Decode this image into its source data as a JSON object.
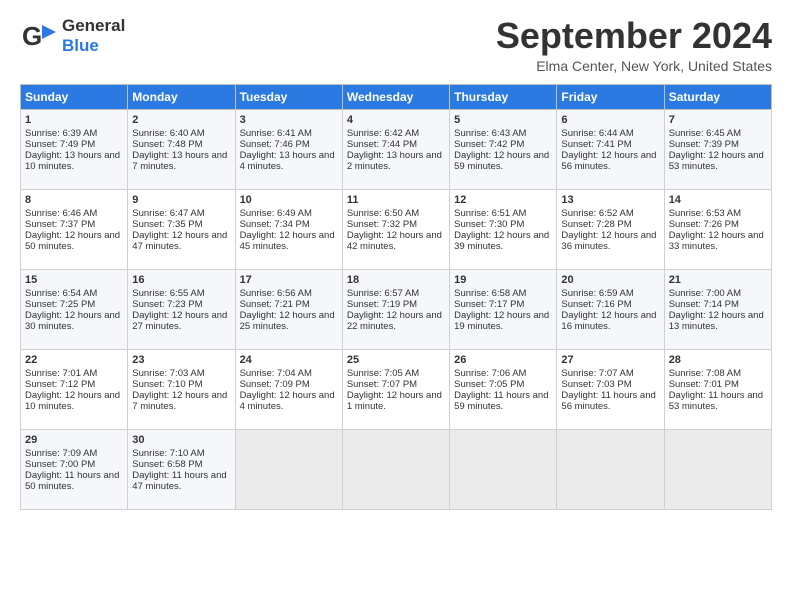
{
  "header": {
    "logo_line1": "General",
    "logo_line2": "Blue",
    "title": "September 2024",
    "location": "Elma Center, New York, United States"
  },
  "days_of_week": [
    "Sunday",
    "Monday",
    "Tuesday",
    "Wednesday",
    "Thursday",
    "Friday",
    "Saturday"
  ],
  "weeks": [
    [
      {
        "day": 1,
        "info": "Sunrise: 6:39 AM\nSunset: 7:49 PM\nDaylight: 13 hours and 10 minutes."
      },
      {
        "day": 2,
        "info": "Sunrise: 6:40 AM\nSunset: 7:48 PM\nDaylight: 13 hours and 7 minutes."
      },
      {
        "day": 3,
        "info": "Sunrise: 6:41 AM\nSunset: 7:46 PM\nDaylight: 13 hours and 4 minutes."
      },
      {
        "day": 4,
        "info": "Sunrise: 6:42 AM\nSunset: 7:44 PM\nDaylight: 13 hours and 2 minutes."
      },
      {
        "day": 5,
        "info": "Sunrise: 6:43 AM\nSunset: 7:42 PM\nDaylight: 12 hours and 59 minutes."
      },
      {
        "day": 6,
        "info": "Sunrise: 6:44 AM\nSunset: 7:41 PM\nDaylight: 12 hours and 56 minutes."
      },
      {
        "day": 7,
        "info": "Sunrise: 6:45 AM\nSunset: 7:39 PM\nDaylight: 12 hours and 53 minutes."
      }
    ],
    [
      {
        "day": 8,
        "info": "Sunrise: 6:46 AM\nSunset: 7:37 PM\nDaylight: 12 hours and 50 minutes."
      },
      {
        "day": 9,
        "info": "Sunrise: 6:47 AM\nSunset: 7:35 PM\nDaylight: 12 hours and 47 minutes."
      },
      {
        "day": 10,
        "info": "Sunrise: 6:49 AM\nSunset: 7:34 PM\nDaylight: 12 hours and 45 minutes."
      },
      {
        "day": 11,
        "info": "Sunrise: 6:50 AM\nSunset: 7:32 PM\nDaylight: 12 hours and 42 minutes."
      },
      {
        "day": 12,
        "info": "Sunrise: 6:51 AM\nSunset: 7:30 PM\nDaylight: 12 hours and 39 minutes."
      },
      {
        "day": 13,
        "info": "Sunrise: 6:52 AM\nSunset: 7:28 PM\nDaylight: 12 hours and 36 minutes."
      },
      {
        "day": 14,
        "info": "Sunrise: 6:53 AM\nSunset: 7:26 PM\nDaylight: 12 hours and 33 minutes."
      }
    ],
    [
      {
        "day": 15,
        "info": "Sunrise: 6:54 AM\nSunset: 7:25 PM\nDaylight: 12 hours and 30 minutes."
      },
      {
        "day": 16,
        "info": "Sunrise: 6:55 AM\nSunset: 7:23 PM\nDaylight: 12 hours and 27 minutes."
      },
      {
        "day": 17,
        "info": "Sunrise: 6:56 AM\nSunset: 7:21 PM\nDaylight: 12 hours and 25 minutes."
      },
      {
        "day": 18,
        "info": "Sunrise: 6:57 AM\nSunset: 7:19 PM\nDaylight: 12 hours and 22 minutes."
      },
      {
        "day": 19,
        "info": "Sunrise: 6:58 AM\nSunset: 7:17 PM\nDaylight: 12 hours and 19 minutes."
      },
      {
        "day": 20,
        "info": "Sunrise: 6:59 AM\nSunset: 7:16 PM\nDaylight: 12 hours and 16 minutes."
      },
      {
        "day": 21,
        "info": "Sunrise: 7:00 AM\nSunset: 7:14 PM\nDaylight: 12 hours and 13 minutes."
      }
    ],
    [
      {
        "day": 22,
        "info": "Sunrise: 7:01 AM\nSunset: 7:12 PM\nDaylight: 12 hours and 10 minutes."
      },
      {
        "day": 23,
        "info": "Sunrise: 7:03 AM\nSunset: 7:10 PM\nDaylight: 12 hours and 7 minutes."
      },
      {
        "day": 24,
        "info": "Sunrise: 7:04 AM\nSunset: 7:09 PM\nDaylight: 12 hours and 4 minutes."
      },
      {
        "day": 25,
        "info": "Sunrise: 7:05 AM\nSunset: 7:07 PM\nDaylight: 12 hours and 1 minute."
      },
      {
        "day": 26,
        "info": "Sunrise: 7:06 AM\nSunset: 7:05 PM\nDaylight: 11 hours and 59 minutes."
      },
      {
        "day": 27,
        "info": "Sunrise: 7:07 AM\nSunset: 7:03 PM\nDaylight: 11 hours and 56 minutes."
      },
      {
        "day": 28,
        "info": "Sunrise: 7:08 AM\nSunset: 7:01 PM\nDaylight: 11 hours and 53 minutes."
      }
    ],
    [
      {
        "day": 29,
        "info": "Sunrise: 7:09 AM\nSunset: 7:00 PM\nDaylight: 11 hours and 50 minutes."
      },
      {
        "day": 30,
        "info": "Sunrise: 7:10 AM\nSunset: 6:58 PM\nDaylight: 11 hours and 47 minutes."
      },
      null,
      null,
      null,
      null,
      null
    ]
  ]
}
